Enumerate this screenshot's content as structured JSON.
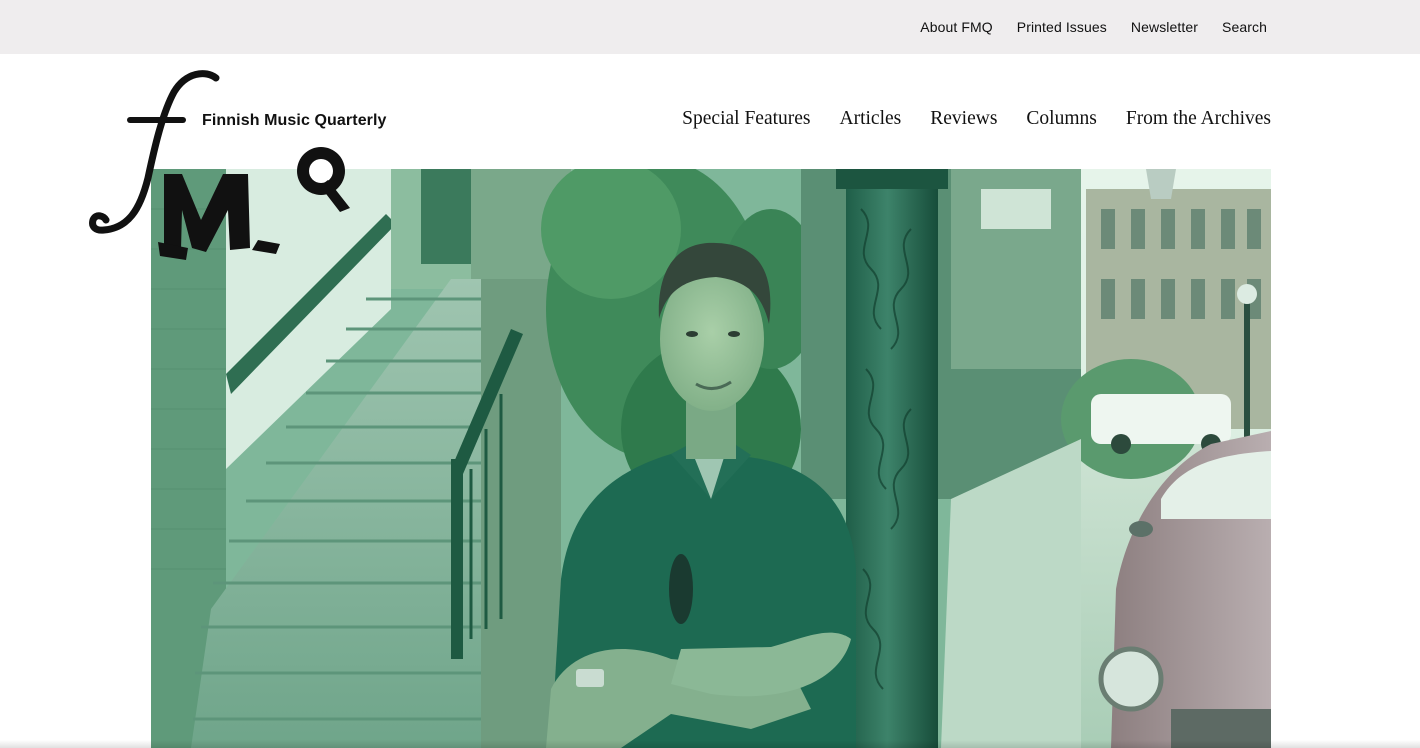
{
  "topbar": {
    "links": [
      {
        "label": "About FMQ"
      },
      {
        "label": "Printed Issues"
      },
      {
        "label": "Newsletter"
      },
      {
        "label": "Search"
      }
    ]
  },
  "header": {
    "logo": {
      "title": "Finnish Music Quarterly",
      "mark_letters": "fMQ"
    },
    "nav": [
      {
        "label": "Special Features"
      },
      {
        "label": "Articles"
      },
      {
        "label": "Reviews"
      },
      {
        "label": "Columns"
      },
      {
        "label": "From the Archives"
      }
    ]
  },
  "colors": {
    "topbar_bg": "#efedee",
    "page_bg": "#ffffff",
    "text": "#111111",
    "hero_tint": "#2f8f6a"
  }
}
